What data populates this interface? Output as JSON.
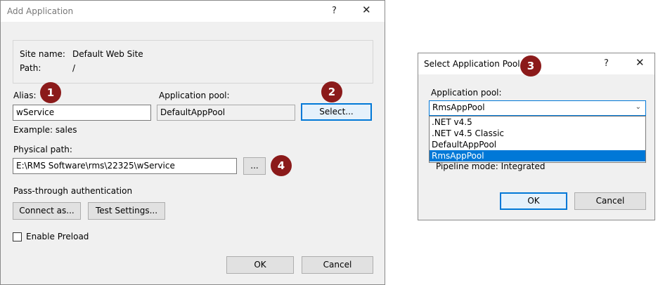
{
  "add_app": {
    "title": "Add Application",
    "help": "?",
    "close": "✕",
    "site_name_label": "Site name:",
    "site_name_value": "Default Web Site",
    "path_label": "Path:",
    "path_value": "/",
    "alias_label": "Alias:",
    "alias_value": "wService",
    "alias_example": "Example: sales",
    "app_pool_label": "Application pool:",
    "app_pool_value": "DefaultAppPool",
    "select_button": "Select...",
    "physical_path_label": "Physical path:",
    "physical_path_value": "E:\\RMS Software\\rms\\22325\\wService",
    "browse_button": "...",
    "pass_through_label": "Pass-through authentication",
    "connect_as_button": "Connect as...",
    "test_settings_button": "Test Settings...",
    "enable_preload_label": "Enable Preload",
    "enable_preload_checked": false,
    "ok_button": "OK",
    "cancel_button": "Cancel"
  },
  "select_pool": {
    "title": "Select Application Pool",
    "help": "?",
    "close": "✕",
    "pool_label": "Application pool:",
    "selected_value": "RmsAppPool",
    "options": [
      ".NET v4.5",
      ".NET v4.5 Classic",
      "DefaultAppPool",
      "RmsAppPool"
    ],
    "pipeline_mode": "Pipeline mode: Integrated",
    "ok_button": "OK",
    "cancel_button": "Cancel"
  },
  "badges": [
    "1",
    "2",
    "3",
    "4"
  ],
  "colors": {
    "badge": "#8b1a1a",
    "accent": "#0078d7"
  }
}
